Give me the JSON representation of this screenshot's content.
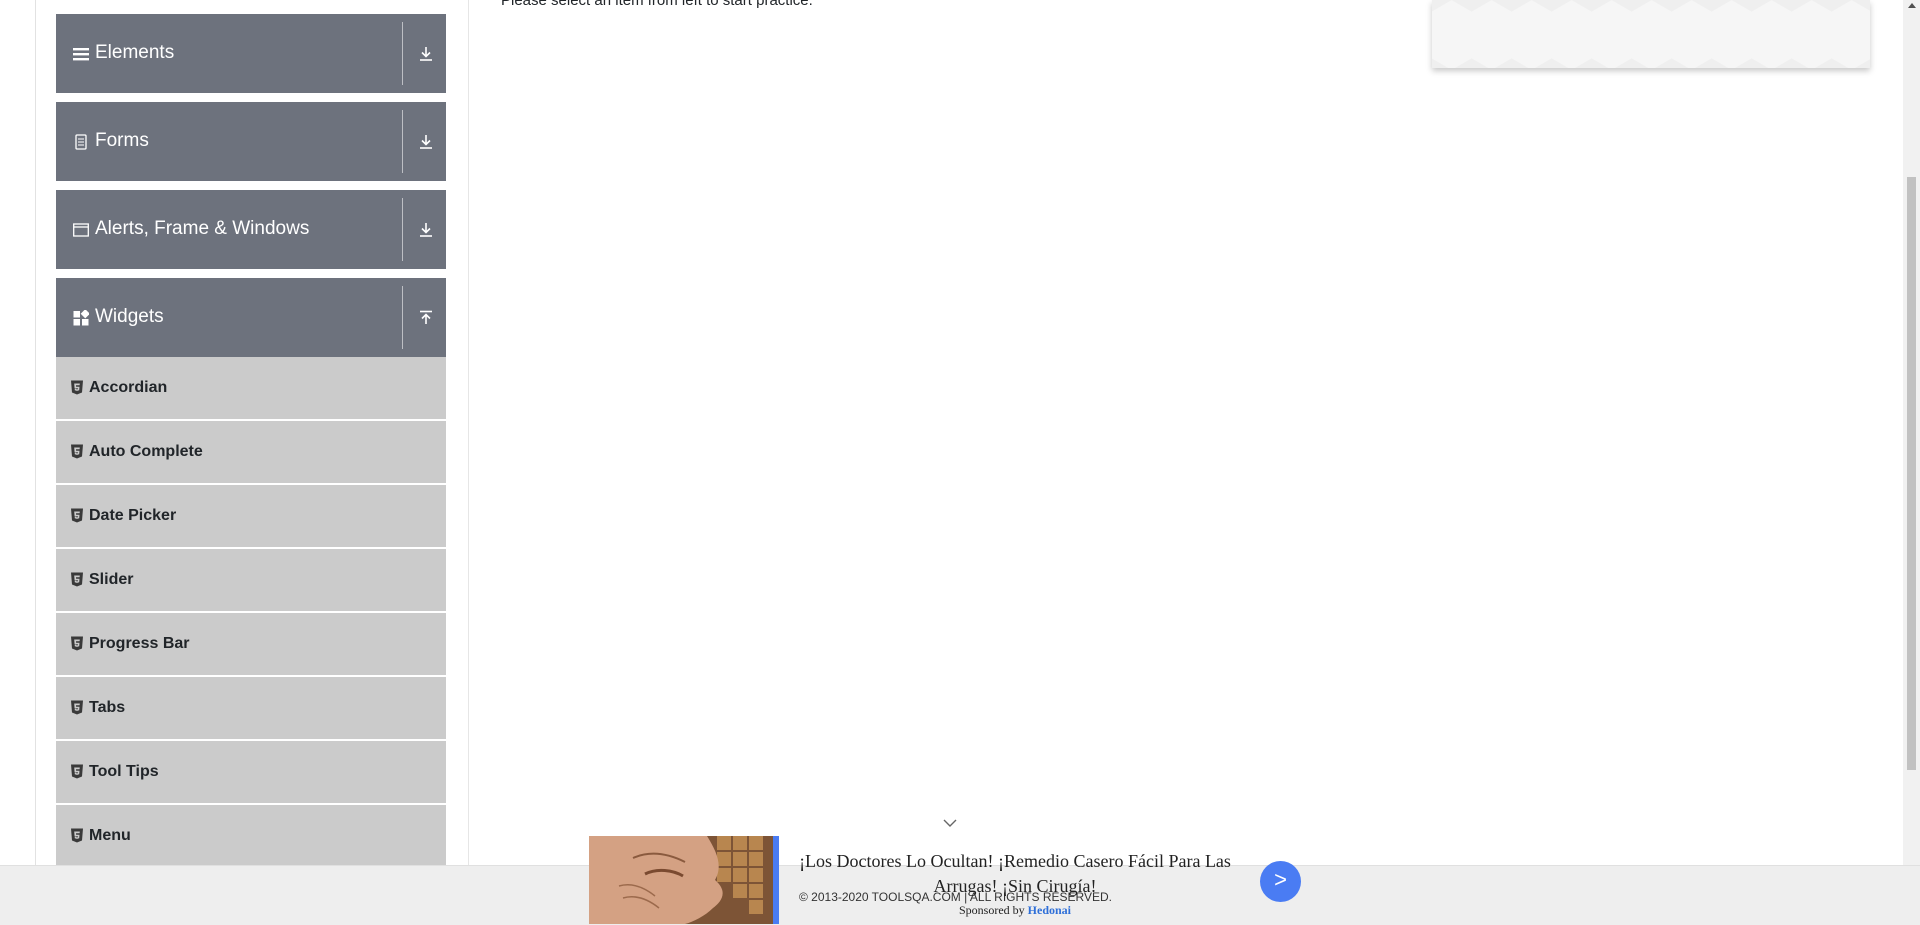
{
  "sidebar": {
    "groups": [
      {
        "title": "Elements",
        "icon": "hamburger-icon",
        "arrow": "download-icon"
      },
      {
        "title": "Forms",
        "icon": "form-icon",
        "arrow": "download-icon"
      },
      {
        "title": "Alerts, Frame & Windows",
        "icon": "window-icon",
        "arrow": "download-icon"
      },
      {
        "title": "Widgets",
        "icon": "widgets-icon",
        "arrow": "upload-icon"
      }
    ],
    "widget_items": [
      {
        "label": "Accordian"
      },
      {
        "label": "Auto Complete"
      },
      {
        "label": "Date Picker"
      },
      {
        "label": "Slider"
      },
      {
        "label": "Progress Bar"
      },
      {
        "label": "Tabs"
      },
      {
        "label": "Tool Tips"
      },
      {
        "label": "Menu"
      }
    ]
  },
  "main": {
    "practice_message": "Please select an item from left to start practice."
  },
  "footer": {
    "copyright": "© 2013-2020 TOOLSQA.COM | ALL RIGHTS RESERVED."
  },
  "ad": {
    "headline": "¡Los Doctores Lo Ocultan! ¡Remedio Casero Fácil Para Las Arrugas! ¡Sin Cirugía!",
    "sponsored_prefix": "Sponsored by",
    "sponsor_name": "Hedonai",
    "go_label": ">"
  },
  "colors": {
    "group_header": "#6d727d",
    "sub_item": "#cbcbcb",
    "ad_accent": "#4a7cf3"
  }
}
